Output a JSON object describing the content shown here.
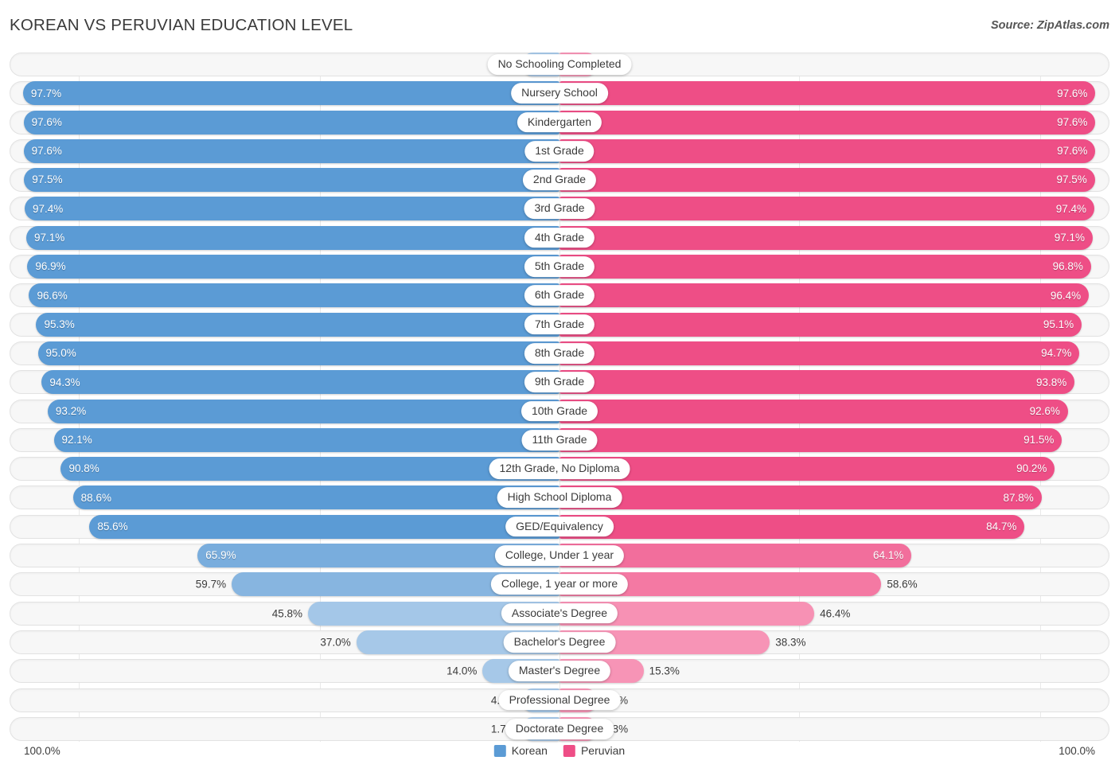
{
  "header": {
    "title": "KOREAN VS PERUVIAN EDUCATION LEVEL",
    "source": "Source: ZipAtlas.com"
  },
  "axis": {
    "left_max": "100.0%",
    "right_max": "100.0%"
  },
  "legend": {
    "items": [
      {
        "label": "Korean",
        "color": "#5b9bd5"
      },
      {
        "label": "Peruvian",
        "color": "#ee4e86"
      }
    ]
  },
  "colors": {
    "korean_strong": "#5b9bd5",
    "korean_light": "#a6c8e8",
    "peruvian_strong": "#ee4e86",
    "peruvian_light": "#f794b6",
    "track": "#f7f7f7",
    "track_border": "#e2e2e2"
  },
  "chart_data": {
    "type": "bar",
    "title": "KOREAN VS PERUVIAN EDUCATION LEVEL",
    "subtype": "diverging-bidirectional",
    "xlabel": "",
    "ylabel": "",
    "xlim": [
      0,
      100
    ],
    "grid": true,
    "legend_position": "bottom-center",
    "categories": [
      "No Schooling Completed",
      "Nursery School",
      "Kindergarten",
      "1st Grade",
      "2nd Grade",
      "3rd Grade",
      "4th Grade",
      "5th Grade",
      "6th Grade",
      "7th Grade",
      "8th Grade",
      "9th Grade",
      "10th Grade",
      "11th Grade",
      "12th Grade, No Diploma",
      "High School Diploma",
      "GED/Equivalency",
      "College, Under 1 year",
      "College, 1 year or more",
      "Associate's Degree",
      "Bachelor's Degree",
      "Master's Degree",
      "Professional Degree",
      "Doctorate Degree"
    ],
    "series": [
      {
        "name": "Korean",
        "color": "#5b9bd5",
        "values": [
          2.4,
          97.7,
          97.6,
          97.6,
          97.5,
          97.4,
          97.1,
          96.9,
          96.6,
          95.3,
          95.0,
          94.3,
          93.2,
          92.1,
          90.8,
          88.6,
          85.6,
          65.9,
          59.7,
          45.8,
          37.0,
          14.0,
          4.1,
          1.7
        ],
        "labels": [
          "2.4%",
          "97.7%",
          "97.6%",
          "97.6%",
          "97.5%",
          "97.4%",
          "97.1%",
          "96.9%",
          "96.6%",
          "95.3%",
          "95.0%",
          "94.3%",
          "93.2%",
          "92.1%",
          "90.8%",
          "88.6%",
          "85.6%",
          "65.9%",
          "59.7%",
          "45.8%",
          "37.0%",
          "14.0%",
          "4.1%",
          "1.7%"
        ]
      },
      {
        "name": "Peruvian",
        "color": "#ee4e86",
        "values": [
          2.4,
          97.6,
          97.6,
          97.6,
          97.5,
          97.4,
          97.1,
          96.8,
          96.4,
          95.1,
          94.7,
          93.8,
          92.6,
          91.5,
          90.2,
          87.8,
          84.7,
          64.1,
          58.6,
          46.4,
          38.3,
          15.3,
          4.5,
          1.8
        ],
        "labels": [
          "2.4%",
          "97.6%",
          "97.6%",
          "97.6%",
          "97.5%",
          "97.4%",
          "97.1%",
          "96.8%",
          "96.4%",
          "95.1%",
          "94.7%",
          "93.8%",
          "92.6%",
          "91.5%",
          "90.2%",
          "87.8%",
          "84.7%",
          "64.1%",
          "58.6%",
          "46.4%",
          "38.3%",
          "15.3%",
          "4.5%",
          "1.8%"
        ]
      }
    ]
  }
}
